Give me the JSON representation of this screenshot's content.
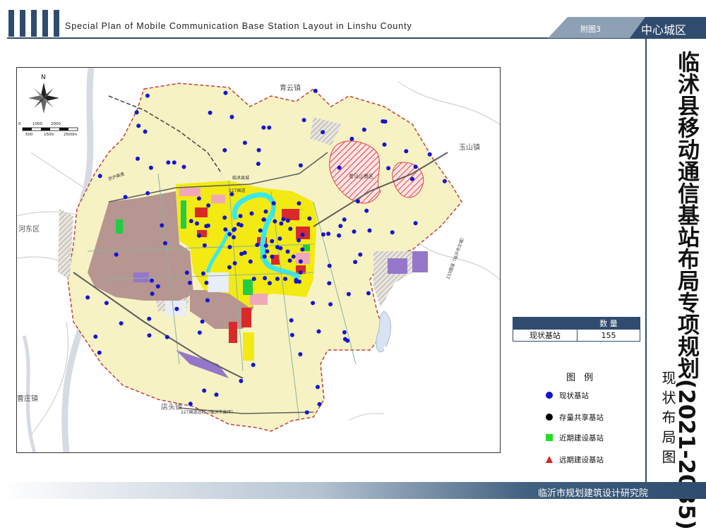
{
  "header": {
    "title": "Special Plan of Mobile Communication Base Station Layout in Linshu County",
    "tab_label": "附图3",
    "tab_region": "中心城区"
  },
  "right_panel": {
    "main_title": "临沭县移动通信基站布局专项规划(2021-2035)",
    "sub_title": "现状布局图"
  },
  "footer": {
    "org": "临沂市规划建筑设计研究院"
  },
  "stats_table": {
    "col_header": "数 量",
    "row_label": "现状基站",
    "row_value": "155"
  },
  "legend": {
    "title": "图 例",
    "items": [
      {
        "label": "现状基站",
        "symbol": "blue-circle",
        "color": "#1414d2"
      },
      {
        "label": "存量共享基站",
        "symbol": "black-circle",
        "color": "#000000"
      },
      {
        "label": "近期建设基站",
        "symbol": "green-square",
        "color": "#22dd22"
      },
      {
        "label": "远期建设基站",
        "symbol": "red-triangle",
        "color": "#dd2222"
      }
    ]
  },
  "map": {
    "north_label": "N",
    "scale_top": [
      "0",
      "1000",
      "2000"
    ],
    "scale_bottom": [
      "500",
      "1500",
      "2500m"
    ],
    "places": [
      "青云镇",
      "玉山镇",
      "河东区",
      "曹庄镇",
      "店头镇",
      "苍马山景区"
    ],
    "roads": [
      "临沭县城",
      "227国道",
      "227国道连线（临沭市高环）",
      "233国道（临沂市交城）",
      "京沪高速"
    ],
    "site_count": 155
  },
  "colors": {
    "brand_blue": "#2f4c6e",
    "site_blue": "#1414d2",
    "rural_yellow": "#f6f2c4",
    "urban_brown": "#b79590",
    "commercial_yellow": "#f2ea12",
    "water_cyan": "#38e8f0",
    "park_green": "#22cc44"
  },
  "icons": [
    "north-arrow-icon"
  ]
}
